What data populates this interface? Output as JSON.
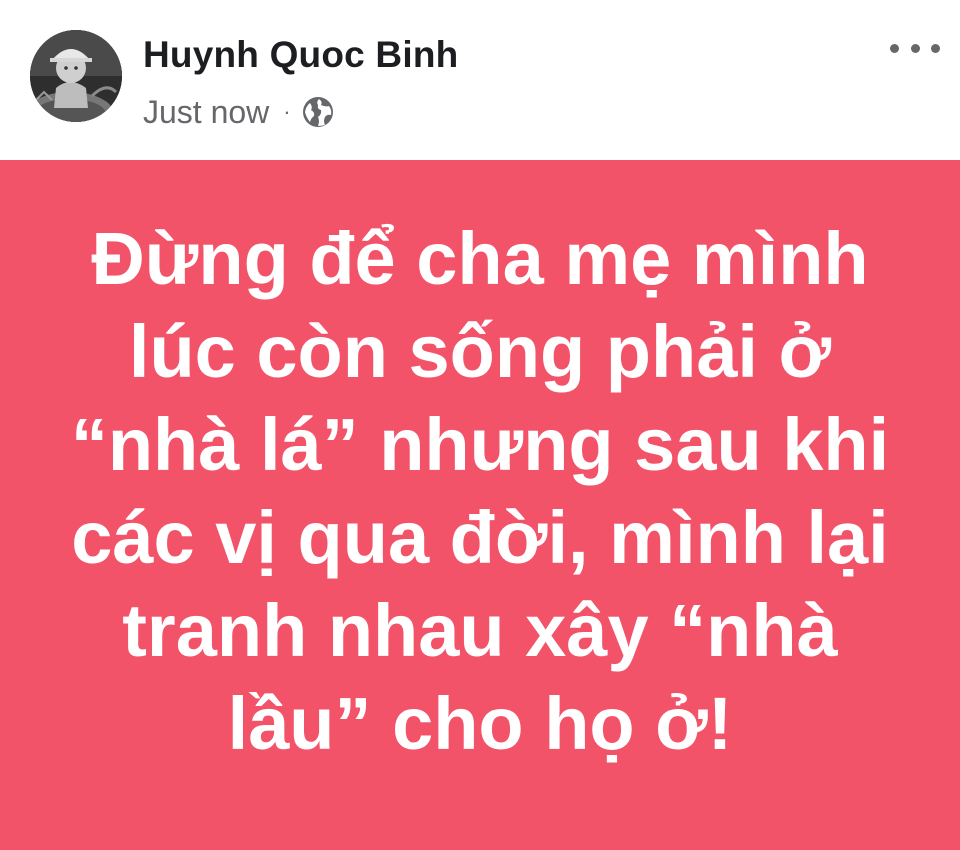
{
  "post": {
    "author": {
      "name": "Huynh Quoc Binh",
      "avatar_icon": "child-portrait-avatar"
    },
    "timestamp": "Just now",
    "separator": "·",
    "audience_icon": "globe-icon",
    "more_icon": "more-options-icon",
    "status_text": "Đừng để cha mẹ mình lúc còn sống phải ở “nhà lá” nhưng sau khi các vị qua đời, mình lại tranh nhau xây “nhà lầu” cho họ ở!",
    "colors": {
      "card_background": "#f35369",
      "status_text": "#ffffff",
      "author_name": "#1c1e21",
      "meta_text": "#65676b"
    }
  }
}
